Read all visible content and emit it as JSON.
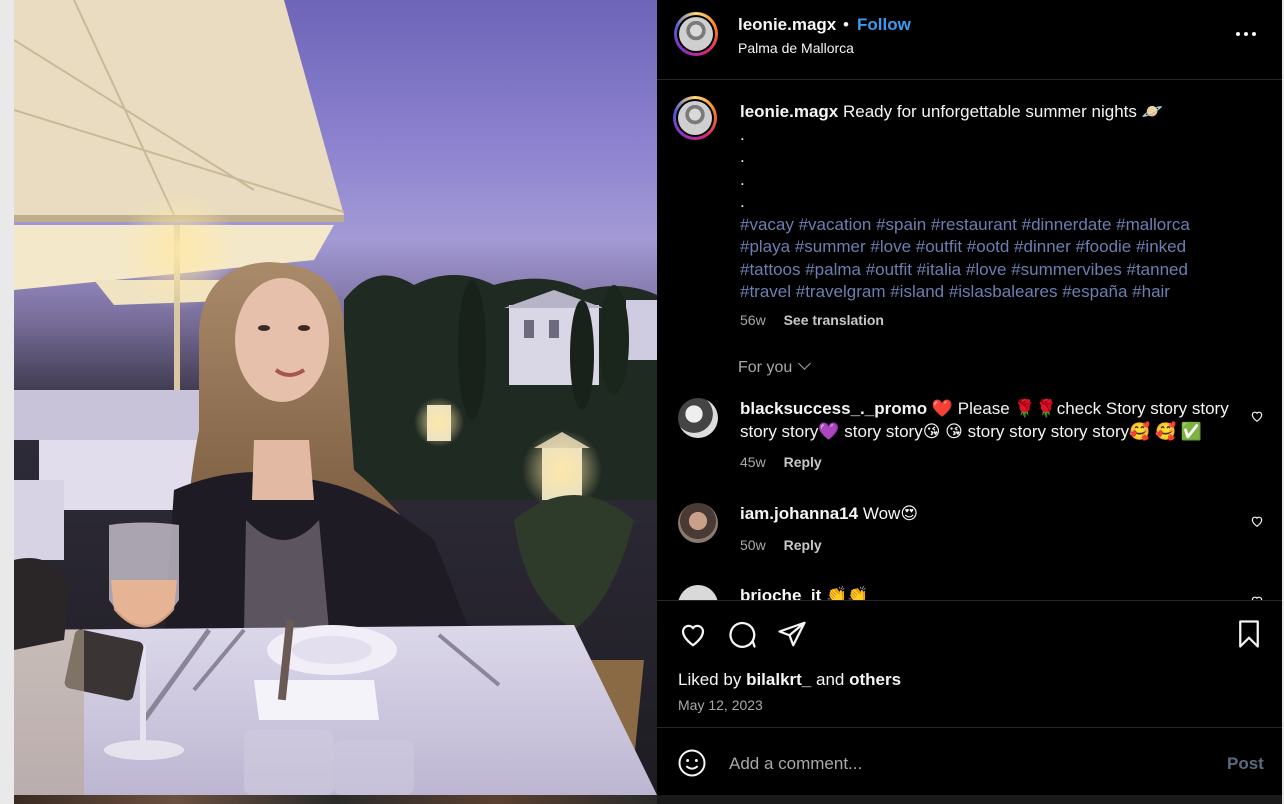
{
  "post": {
    "username": "leonie.magx",
    "separator": "•",
    "follow_label": "Follow",
    "location": "Palma de Mallorca",
    "caption_text": "Ready for unforgettable summer nights 🪐",
    "caption_dots": [
      ".",
      ".",
      ".",
      "."
    ],
    "hashtags": "#vacay #vacation #spain #restaurant #dinnerdate #mallorca #playa #summer #love #outfit #ootd #dinner #foodie #inked #tattoos #palma #outfit #italia #love #summervibes #tanned #travel #travelgram #island #islasbaleares #españa #hair",
    "caption_age": "56w",
    "see_translation": "See translation",
    "for_you_label": "For you"
  },
  "comments": [
    {
      "username": "blacksuccess_._promo",
      "text": "❤️ Please 🌹🌹check Story story story story story💜  story story😘 😘  story story story story🥰 🥰 ✅",
      "age": "45w",
      "reply_label": "Reply"
    },
    {
      "username": "iam.johanna14",
      "text": "Wow😍",
      "age": "50w",
      "reply_label": "Reply"
    },
    {
      "username": "brioche_it",
      "text": "👏👏",
      "age": "",
      "reply_label": ""
    }
  ],
  "actions": {
    "liked_by_prefix": "Liked by",
    "liked_by_user": "bilalkrt_",
    "liked_by_and": "and",
    "liked_by_others": "others",
    "date": "May 12, 2023"
  },
  "comment_box": {
    "placeholder": "Add a comment...",
    "post_label": "Post"
  },
  "icons": [
    "more-icon",
    "heart-icon",
    "comment-icon",
    "share-icon",
    "bookmark-icon",
    "emoji-icon",
    "small-heart-icon",
    "chevron-down-icon"
  ],
  "colors": {
    "background": "#000000",
    "link_blue": "#3a9bf0",
    "hashtag": "#6c7fb0",
    "muted": "#a8a8a8"
  }
}
